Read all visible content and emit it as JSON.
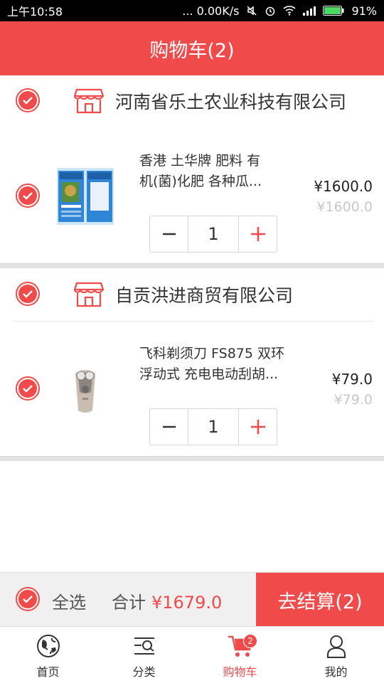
{
  "status_bar": {
    "time": "上午10:58",
    "network_speed": "... 0.00K/s",
    "battery": "91%"
  },
  "header": {
    "title": "购物车(2)"
  },
  "shops": [
    {
      "name": "河南省乐土农业科技有限公司",
      "items": [
        {
          "title_line1": "香港 土华牌 肥料 有",
          "title_line2": "机(菌)化肥 各种瓜...",
          "price": "¥1600.0",
          "original_price": "¥1600.0",
          "quantity": "1"
        }
      ]
    },
    {
      "name": "自贡洪进商贸有限公司",
      "items": [
        {
          "title_line1": "飞科剃须刀 FS875 双环",
          "title_line2": "浮动式 充电电动刮胡...",
          "price": "¥79.0",
          "original_price": "¥79.0",
          "quantity": "1"
        }
      ]
    }
  ],
  "stepper": {
    "minus": "−",
    "plus": "+"
  },
  "checkout": {
    "select_all": "全选",
    "total_label": "合计",
    "total_amount": "¥1679.0",
    "button": "去结算(2)"
  },
  "tabs": [
    {
      "label": "首页",
      "icon": "home-globe-icon"
    },
    {
      "label": "分类",
      "icon": "category-search-icon"
    },
    {
      "label": "购物车",
      "icon": "cart-icon",
      "badge": "2",
      "active": true
    },
    {
      "label": "我的",
      "icon": "user-icon"
    }
  ],
  "colors": {
    "accent": "#f04a4a",
    "text": "#333333",
    "muted": "#c8c8c8"
  }
}
